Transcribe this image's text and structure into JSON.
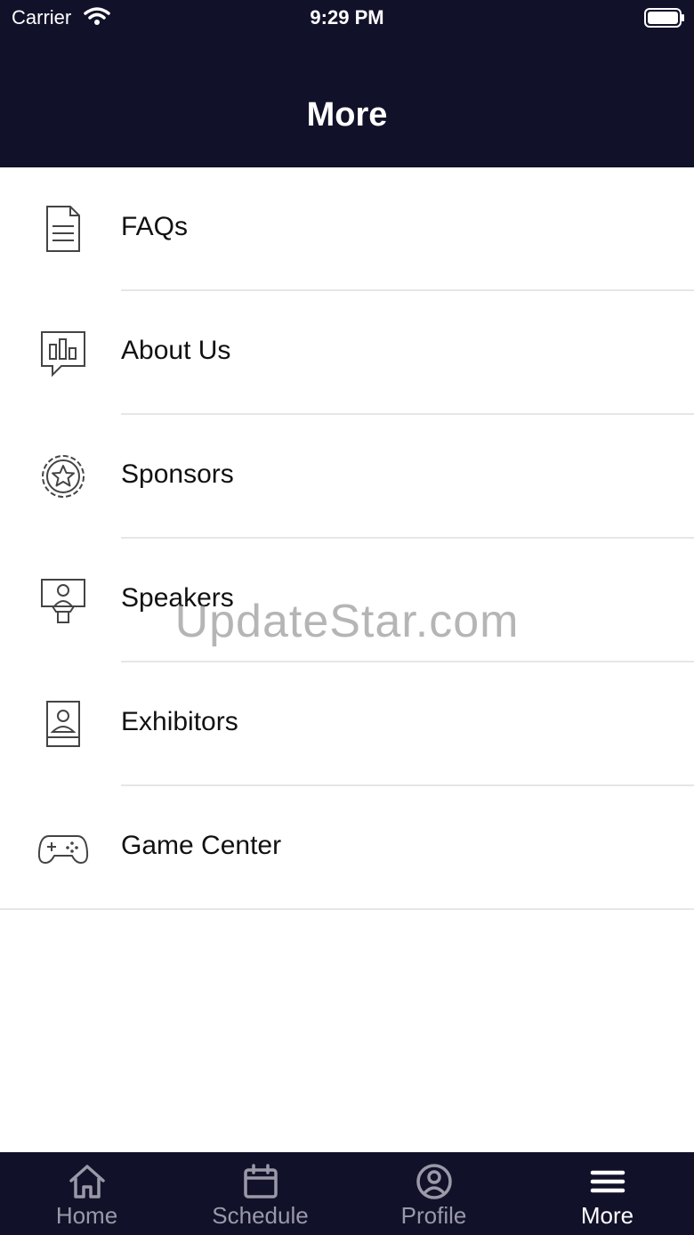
{
  "status_bar": {
    "carrier": "Carrier",
    "time": "9:29 PM"
  },
  "header": {
    "title": "More"
  },
  "menu": {
    "items": [
      {
        "label": "FAQs",
        "icon": "document-icon"
      },
      {
        "label": "About Us",
        "icon": "chat-chart-icon"
      },
      {
        "label": "Sponsors",
        "icon": "star-badge-icon"
      },
      {
        "label": "Speakers",
        "icon": "speaker-podium-icon"
      },
      {
        "label": "Exhibitors",
        "icon": "exhibitor-booth-icon"
      },
      {
        "label": "Game Center",
        "icon": "gamepad-icon"
      }
    ]
  },
  "watermark": "UpdateStar.com",
  "tabbar": {
    "tabs": [
      {
        "label": "Home",
        "icon": "home-icon"
      },
      {
        "label": "Schedule",
        "icon": "calendar-icon"
      },
      {
        "label": "Profile",
        "icon": "profile-icon"
      },
      {
        "label": "More",
        "icon": "menu-icon",
        "active": true
      }
    ]
  },
  "colors": {
    "header_bg": "#12112a",
    "tab_inactive": "#9a99a8",
    "tab_active": "#ffffff"
  }
}
